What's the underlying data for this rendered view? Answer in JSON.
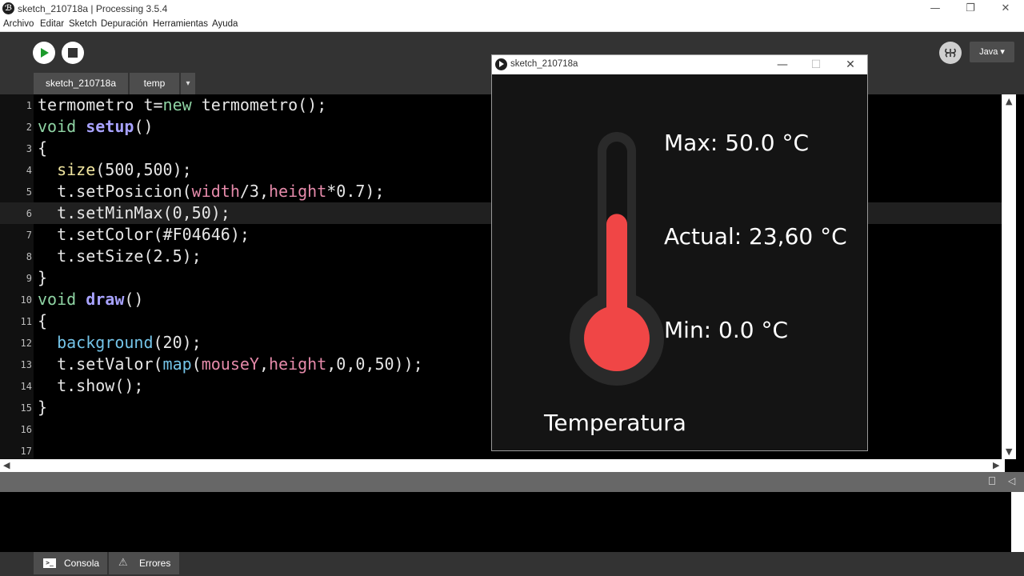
{
  "window": {
    "title": "sketch_210718a | Processing 3.5.4",
    "app_icon_glyph": "ℬ",
    "minimize": "—",
    "maximize": "❐",
    "close": "✕"
  },
  "menu": [
    "Archivo",
    "Editar",
    "Sketch",
    "Depuración",
    "Herramientas",
    "Ayuda"
  ],
  "toolbar": {
    "run_icon": "play-icon",
    "stop_icon": "stop-icon",
    "debugger_icon": "butterfly-icon",
    "mode": "Java ▾"
  },
  "tabs": [
    {
      "label": "sketch_210718a",
      "active": true
    },
    {
      "label": "temp",
      "active": false
    }
  ],
  "tab_menu": "▾",
  "editor": {
    "active_line": 6,
    "lines": [
      {
        "num": "1",
        "tokens": [
          [
            "termometro t=",
            ""
          ],
          [
            "new",
            "kw"
          ],
          [
            " termometro();",
            ""
          ]
        ]
      },
      {
        "num": "2",
        "tokens": [
          [
            "void",
            "kw"
          ],
          [
            " ",
            ""
          ],
          [
            "setup",
            "fn"
          ],
          [
            "()",
            ""
          ]
        ]
      },
      {
        "num": "3",
        "tokens": [
          [
            "{",
            ""
          ]
        ]
      },
      {
        "num": "4",
        "tokens": [
          [
            "  ",
            ""
          ],
          [
            "size",
            "bi"
          ],
          [
            "(500,500);",
            ""
          ]
        ]
      },
      {
        "num": "5",
        "tokens": [
          [
            "  t.setPosicion(",
            ""
          ],
          [
            "width",
            "vr"
          ],
          [
            "/3,",
            ""
          ],
          [
            "height",
            "vr"
          ],
          [
            "*0.7);",
            ""
          ]
        ]
      },
      {
        "num": "6",
        "tokens": [
          [
            "  t.setMinMax(0,50);",
            ""
          ]
        ]
      },
      {
        "num": "7",
        "tokens": [
          [
            "  t.setColor(#F04646);",
            ""
          ]
        ]
      },
      {
        "num": "8",
        "tokens": [
          [
            "  t.setSize(2.5);",
            ""
          ]
        ]
      },
      {
        "num": "9",
        "tokens": [
          [
            "}",
            ""
          ]
        ]
      },
      {
        "num": "10",
        "tokens": [
          [
            "void",
            "kw"
          ],
          [
            " ",
            ""
          ],
          [
            "draw",
            "fn"
          ],
          [
            "()",
            ""
          ]
        ]
      },
      {
        "num": "11",
        "tokens": [
          [
            "{",
            ""
          ]
        ]
      },
      {
        "num": "12",
        "tokens": [
          [
            "  ",
            ""
          ],
          [
            "background",
            "cl"
          ],
          [
            "(20);",
            ""
          ]
        ]
      },
      {
        "num": "13",
        "tokens": [
          [
            "  t.setValor(",
            ""
          ],
          [
            "map",
            "cl"
          ],
          [
            "(",
            ""
          ],
          [
            "mouseY",
            "vr"
          ],
          [
            ",",
            ""
          ],
          [
            "height",
            "vr"
          ],
          [
            ",0,0,50));",
            ""
          ]
        ]
      },
      {
        "num": "14",
        "tokens": [
          [
            "  t.show();",
            ""
          ]
        ]
      },
      {
        "num": "15",
        "tokens": [
          [
            "}",
            ""
          ]
        ]
      },
      {
        "num": "16",
        "tokens": []
      },
      {
        "num": "17",
        "tokens": []
      }
    ]
  },
  "sketch_window": {
    "title": "sketch_210718a",
    "max_label": "Max: 50.0 °C",
    "actual_label": "Actual: 23,60 °C",
    "min_label": "Min: 0.0 °C",
    "caption": "Temperatura",
    "value": 23.6,
    "min": 0,
    "max": 50,
    "fill_color": "#F04646",
    "body_color": "#2a2a2a",
    "background": "#141414"
  },
  "console": {
    "tabs": [
      {
        "label": "Consola",
        "icon": "terminal-icon"
      },
      {
        "label": "Errores",
        "icon": "warning-icon"
      }
    ]
  }
}
